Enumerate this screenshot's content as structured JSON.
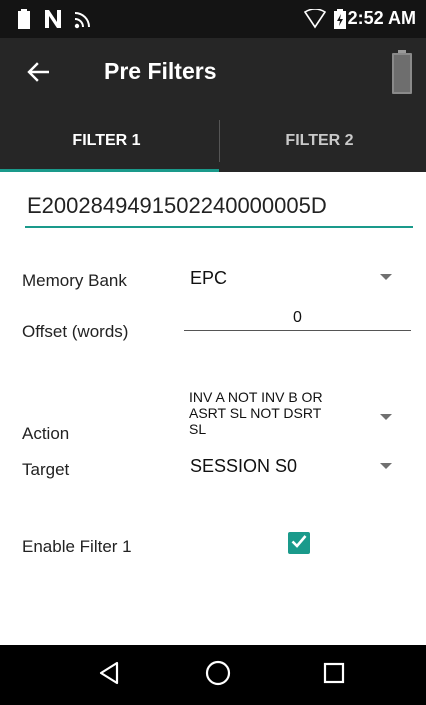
{
  "status_bar": {
    "time": "2:52 AM",
    "icons": [
      "battery-icon",
      "nfc-icon",
      "signal-icon",
      "wifi-icon",
      "charging-battery-icon"
    ]
  },
  "app_bar": {
    "title": "Pre Filters",
    "back_icon": "arrow-left-icon",
    "battery_icon": "battery-indicator-icon"
  },
  "tabs": [
    {
      "label": "FILTER 1",
      "selected": true
    },
    {
      "label": "FILTER 2",
      "selected": false
    }
  ],
  "form": {
    "tag_id": "E2002849491502240000005D",
    "memory_bank": {
      "label": "Memory Bank",
      "value": "EPC"
    },
    "offset": {
      "label": "Offset (words)",
      "value": "0"
    },
    "action": {
      "label": "Action",
      "value_lines": [
        "INV A NOT INV B OR",
        "ASRT SL NOT DSRT",
        "SL"
      ]
    },
    "target": {
      "label": "Target",
      "value": "SESSION S0"
    },
    "enable_filter": {
      "label": "Enable Filter 1",
      "checked": true
    }
  },
  "nav_bar": {
    "icons": [
      "back-triangle-icon",
      "home-circle-icon",
      "recents-square-icon"
    ]
  },
  "colors": {
    "accent": "#1a9a8b",
    "app_bar": "#262626",
    "status_bar": "#141414",
    "nav_bar": "#000000"
  }
}
